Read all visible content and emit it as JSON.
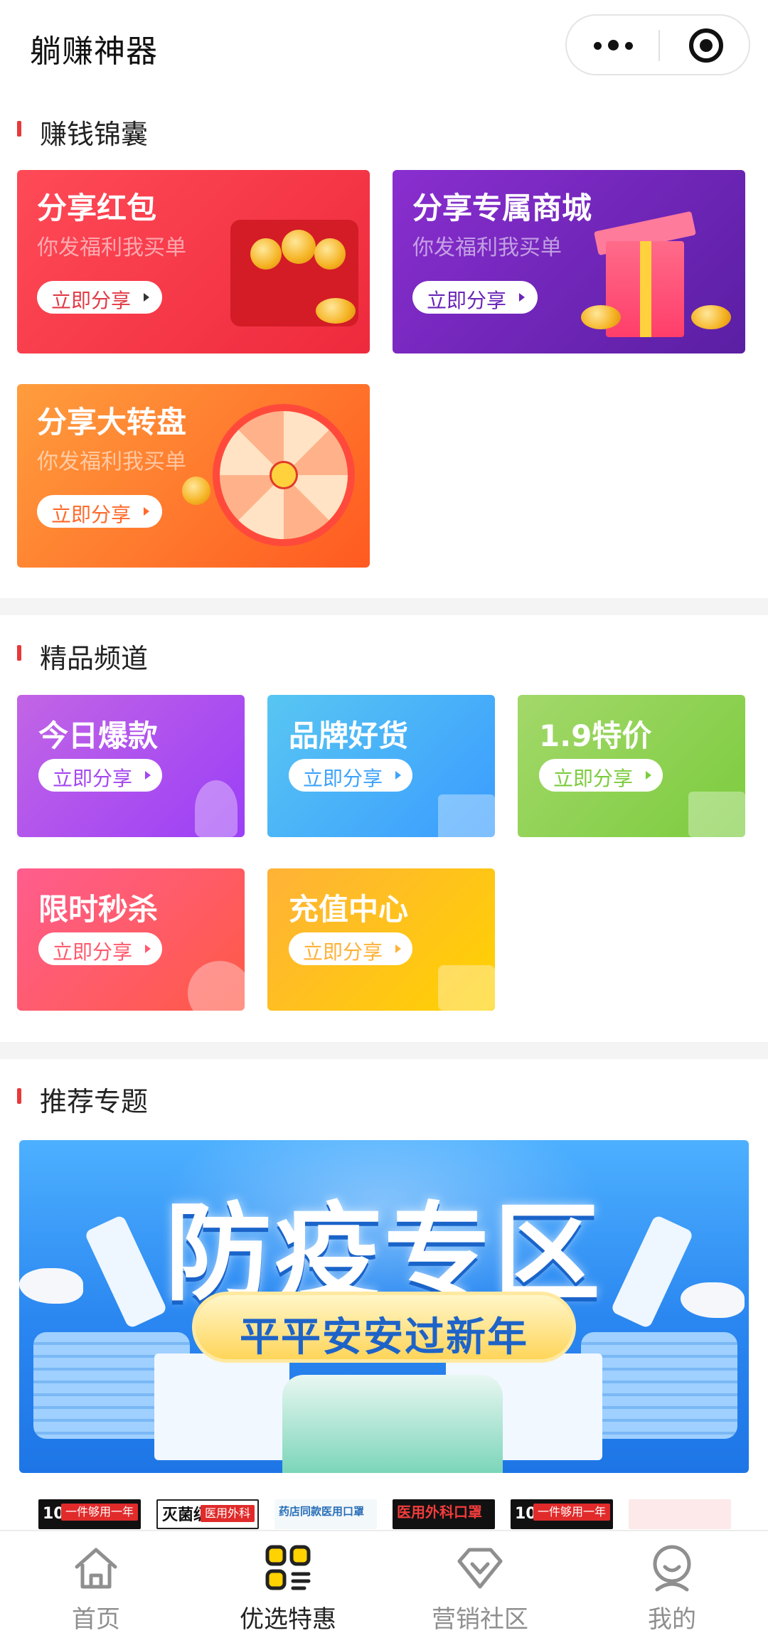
{
  "header": {
    "title": "躺赚神器"
  },
  "sections": {
    "earn": {
      "title": "赚钱锦囊"
    },
    "channels": {
      "title": "精品频道"
    },
    "topics": {
      "title": "推荐专题"
    }
  },
  "earn_cards": [
    {
      "title": "分享红包",
      "subtitle": "你发福利我买单",
      "button": "立即分享"
    },
    {
      "title": "分享专属商城",
      "subtitle": "你发福利我买单",
      "button": "立即分享"
    },
    {
      "title": "分享大转盘",
      "subtitle": "你发福利我买单",
      "button": "立即分享"
    }
  ],
  "channel_cards": [
    {
      "title": "今日爆款",
      "button": "立即分享"
    },
    {
      "title": "品牌好货",
      "button": "立即分享"
    },
    {
      "title": "1.9特价",
      "button": "立即分享"
    },
    {
      "title": "限时秒杀",
      "button": "立即分享"
    },
    {
      "title": "充值中心",
      "button": "立即分享"
    }
  ],
  "banner": {
    "title": "防疫专区",
    "slogan": "平平安安过新年"
  },
  "thumbnails": [
    {
      "text": "100只",
      "tag": "一件够用一年"
    },
    {
      "text": "灭菌级",
      "tag": "医用外科"
    },
    {
      "text": "药店同款医用口罩",
      "tag": ""
    },
    {
      "text": "医用外科口罩",
      "tag": ""
    },
    {
      "text": "100只",
      "tag": "一件够用一年"
    },
    {
      "text": "",
      "tag": ""
    }
  ],
  "tabbar": [
    {
      "label": "首页",
      "icon": "home-icon",
      "active": false
    },
    {
      "label": "优选特惠",
      "icon": "grid-list-icon",
      "active": true
    },
    {
      "label": "营销社区",
      "icon": "diamond-icon",
      "active": false
    },
    {
      "label": "我的",
      "icon": "user-icon",
      "active": false
    }
  ],
  "colors": {
    "accent": "#e8393a",
    "tab_active": "#222222",
    "tab_inactive": "#8f8f8f"
  }
}
